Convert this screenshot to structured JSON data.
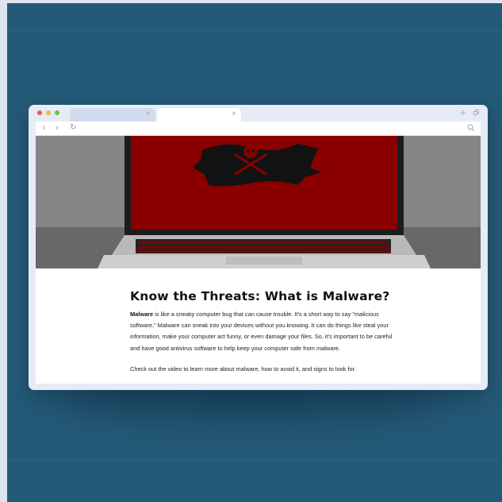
{
  "browser": {
    "tabs": [
      {
        "label": "",
        "active": false
      },
      {
        "label": "",
        "active": true
      }
    ],
    "controls": {
      "close_tab_glyph": "×",
      "new_tab_glyph": "+",
      "back_glyph": "‹",
      "forward_glyph": "›",
      "reload_glyph": "↻"
    }
  },
  "article": {
    "title": "Know the Threats: What is Malware?",
    "intro_bold": "Malware",
    "intro_rest": " is like a sneaky computer bug that can cause trouble. It's a short way to say \"malicious software.\" Malware can sneak into your devices without you knowing. It can do things like steal your information, make your computer act funny, or even damage your files. So, it's important to be careful and have good antivirus software to help keep your computer safe from malware.",
    "cta": "Check out the video to learn more about malware, how to avoid it, and signs to look for."
  },
  "colors": {
    "background": "#245a78",
    "browser_chrome": "#e6ebf6",
    "screen_red": "#8a0000"
  }
}
